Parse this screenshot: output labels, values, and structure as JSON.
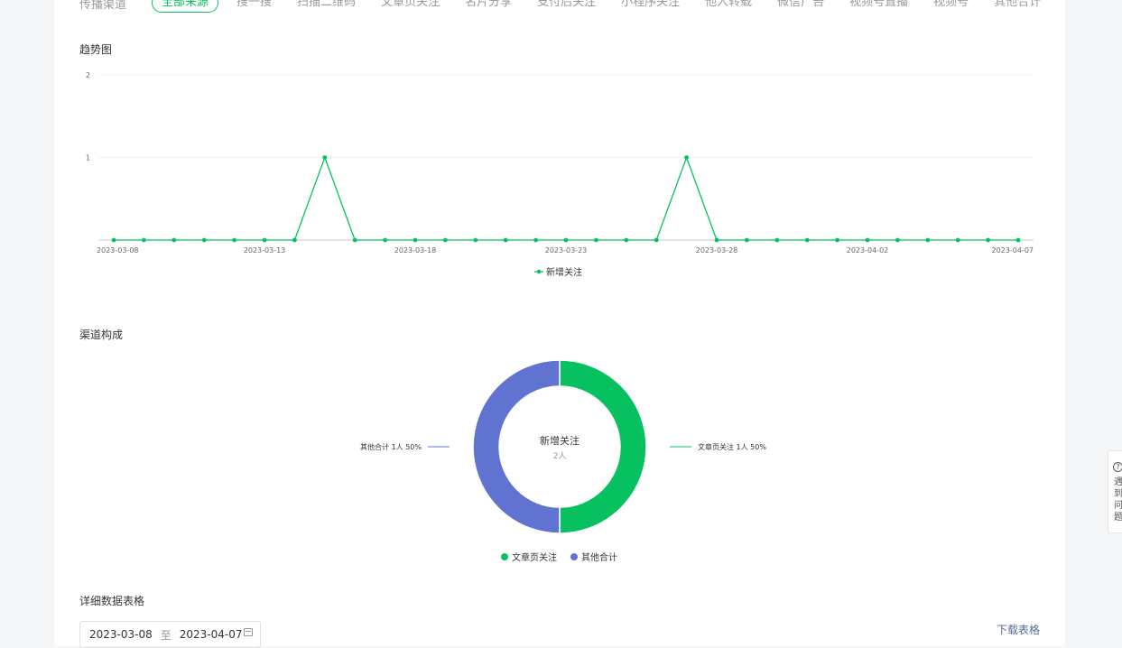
{
  "channels": {
    "label": "传播渠道",
    "tabs": [
      "全部来源",
      "搜一搜",
      "扫描二维码",
      "文章页关注",
      "名片分享",
      "支付后关注",
      "小程序关注",
      "他人转载",
      "微信广告",
      "视频号直播",
      "视频号",
      "其他合计"
    ],
    "active_index": 0
  },
  "trend": {
    "title": "趋势图"
  },
  "composition": {
    "title": "渠道构成"
  },
  "detail": {
    "title": "详细数据表格",
    "date_start": "2023-03-08",
    "date_sep": "至",
    "date_end": "2023-04-07",
    "download_label": "下载表格"
  },
  "feedback": {
    "icon_glyph": "?",
    "label": "遇到问题"
  },
  "colors": {
    "green": "#07c160",
    "blue": "#6173d1"
  },
  "chart_data": [
    {
      "type": "line",
      "title": "趋势图",
      "ylim": [
        0,
        2
      ],
      "yticks": [
        "2",
        "1"
      ],
      "x_tick_labels": [
        "2023-03-08",
        "2023-03-13",
        "2023-03-18",
        "2023-03-23",
        "2023-03-28",
        "2023-04-02",
        "2023-04-07"
      ],
      "x": [
        "2023-03-08",
        "2023-03-09",
        "2023-03-10",
        "2023-03-11",
        "2023-03-12",
        "2023-03-13",
        "2023-03-14",
        "2023-03-15",
        "2023-03-16",
        "2023-03-17",
        "2023-03-18",
        "2023-03-19",
        "2023-03-20",
        "2023-03-21",
        "2023-03-22",
        "2023-03-23",
        "2023-03-24",
        "2023-03-25",
        "2023-03-26",
        "2023-03-27",
        "2023-03-28",
        "2023-03-29",
        "2023-03-30",
        "2023-03-31",
        "2023-04-01",
        "2023-04-02",
        "2023-04-03",
        "2023-04-04",
        "2023-04-05",
        "2023-04-06",
        "2023-04-07"
      ],
      "series": [
        {
          "name": "新增关注",
          "color": "#07c160",
          "values": [
            0,
            0,
            0,
            0,
            0,
            0,
            0,
            1,
            0,
            0,
            0,
            0,
            0,
            0,
            0,
            0,
            0,
            0,
            0,
            1,
            0,
            0,
            0,
            0,
            0,
            0,
            0,
            0,
            0,
            0,
            0
          ]
        }
      ],
      "grid": true,
      "legend": "bottom-center"
    },
    {
      "type": "pie",
      "title": "渠道构成",
      "center_title": "新增关注",
      "center_value": "2人",
      "slices": [
        {
          "name": "文章页关注",
          "value": 1,
          "label": "文章页关注 1人 50%",
          "color": "#07c160"
        },
        {
          "name": "其他合计",
          "value": 1,
          "label": "其他合计 1人 50%",
          "color": "#6173d1"
        }
      ],
      "legend": "bottom-center"
    }
  ]
}
